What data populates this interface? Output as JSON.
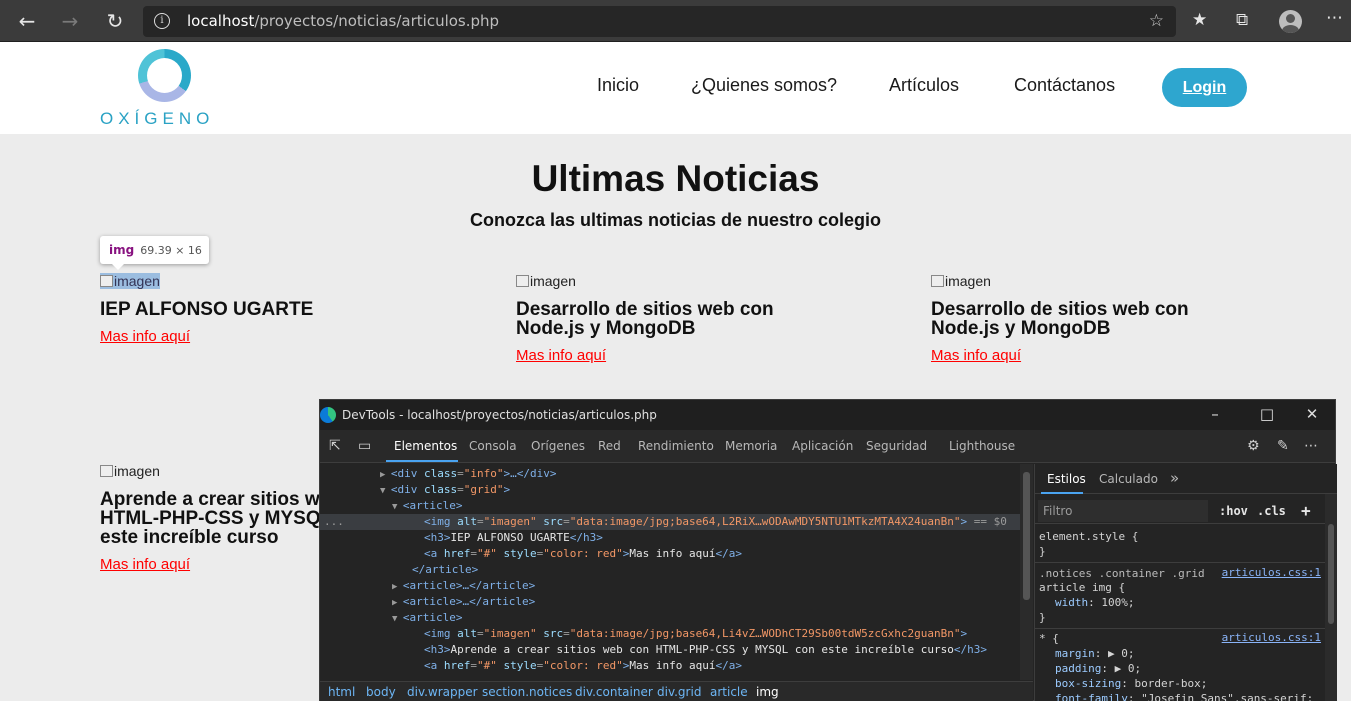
{
  "browser": {
    "url_host": "localhost",
    "url_path": "/proyectos/noticias/articulos.php"
  },
  "site": {
    "logo_text": "OXÍGENO",
    "nav": [
      "Inicio",
      "¿Quienes somos?",
      "Artículos",
      "Contáctanos"
    ],
    "login_label": "Login"
  },
  "main": {
    "title": "Ultimas Noticias",
    "subtitle": "Conozca las ultimas noticias de nuestro colegio",
    "tooltip_tag": "img",
    "tooltip_size": "69.39 × 16",
    "articles": [
      {
        "img_alt": "imagen",
        "title": "IEP ALFONSO UGARTE",
        "link": "Mas info aquí"
      },
      {
        "img_alt": "imagen",
        "title": "Desarrollo de sitios web con Node.js y MongoDB",
        "link": "Mas info aquí"
      },
      {
        "img_alt": "imagen",
        "title": "Desarrollo de sitios web con Node.js y MongoDB",
        "link": "Mas info aquí"
      },
      {
        "img_alt": "imagen",
        "title": "Aprende a crear sitios web con HTML-PHP-CSS y MYSQL con este increíble curso",
        "link": "Mas info aquí"
      }
    ]
  },
  "devtools": {
    "title": "DevTools - localhost/proyectos/noticias/articulos.php",
    "tabs": [
      "Elementos",
      "Consola",
      "Orígenes",
      "Red",
      "Rendimiento",
      "Memoria",
      "Aplicación",
      "Seguridad",
      "Lighthouse"
    ],
    "code": [
      {
        "prefix": "▶",
        "open": "<div",
        "attrs": [
          {
            "n": "class",
            "v": "\"info\""
          }
        ],
        "close": ">…</div>"
      },
      {
        "prefix": "▼",
        "open": "<div",
        "attrs": [
          {
            "n": "class",
            "v": "\"grid\""
          }
        ],
        "close": ">"
      },
      {
        "prefix": "▼",
        "open": "<article>",
        "attrs": [],
        "close": ""
      },
      {
        "prefix": "",
        "open": "<img",
        "attrs": [
          {
            "n": "alt",
            "v": "\"imagen\""
          },
          {
            "n": "src",
            "v": "\"data:image/jpg;base64,L2RiX…wODAwMDY5NTU1MTkzMTA4X24uanBn\""
          }
        ],
        "close": ">",
        "suffix": " == $0"
      },
      {
        "prefix": "",
        "open": "<h3>",
        "attrs": [],
        "close": "",
        "text": "IEP ALFONSO UGARTE",
        "end": "</h3>"
      },
      {
        "prefix": "",
        "open": "<a",
        "attrs": [
          {
            "n": "href",
            "v": "\"#\""
          },
          {
            "n": "style",
            "v": "\"color: red\""
          }
        ],
        "close": ">",
        "text": "Mas info aquí",
        "end": "</a>"
      },
      {
        "prefix": "",
        "open": "</article>",
        "attrs": [],
        "close": ""
      },
      {
        "prefix": "▶",
        "open": "<article>",
        "attrs": [],
        "close": "…</article>"
      },
      {
        "prefix": "▶",
        "open": "<article>",
        "attrs": [],
        "close": "…</article>"
      },
      {
        "prefix": "▼",
        "open": "<article>",
        "attrs": [],
        "close": ""
      },
      {
        "prefix": "",
        "open": "<img",
        "attrs": [
          {
            "n": "alt",
            "v": "\"imagen\""
          },
          {
            "n": "src",
            "v": "\"data:image/jpg;base64,Li4vZ…WODhCT29Sb00tdW5zcGxhc2guanBn\""
          }
        ],
        "close": ">"
      },
      {
        "prefix": "",
        "open": "<h3>",
        "attrs": [],
        "close": "",
        "text": "Aprende a crear sitios web con HTML-PHP-CSS y MYSQL con este increíble curso",
        "end": "</h3>"
      },
      {
        "prefix": "",
        "open": "<a",
        "attrs": [
          {
            "n": "href",
            "v": "\"#\""
          },
          {
            "n": "style",
            "v": "\"color: red\""
          }
        ],
        "close": ">",
        "text": "Mas info aquí",
        "end": "</a>"
      }
    ],
    "breadcrumbs": [
      "html",
      "body",
      "div.wrapper",
      "section.notices",
      "div.container",
      "div.grid",
      "article",
      "img"
    ],
    "styles_tabs": [
      "Estilos",
      "Calculado"
    ],
    "filter_placeholder": "Filtro",
    "hov": ":hov",
    "cls": ".cls",
    "rules": {
      "element_style": "element.style {",
      "close": "}",
      "r1_selector_1": ".notices .container .grid",
      "r1_selector_2": "article img {",
      "r1_source": "articulos.css:1",
      "r1_prop": "width",
      "r1_val": "100%;",
      "r2_selector": "* {",
      "r2_source": "articulos.css:1",
      "r2_props": [
        {
          "p": "margin",
          "v": "▶ 0;"
        },
        {
          "p": "padding",
          "v": "▶ 0;"
        },
        {
          "p": "box-sizing",
          "v": "border-box;"
        },
        {
          "p": "font-family",
          "v": "\"Josefin Sans\",sans-serif;"
        }
      ]
    }
  }
}
